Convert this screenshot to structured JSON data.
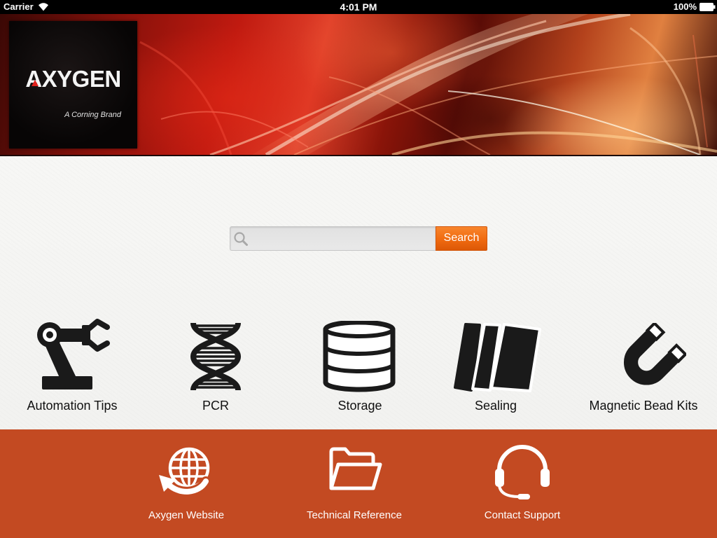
{
  "status_bar": {
    "carrier": "Carrier",
    "time": "4:01 PM",
    "battery_percent": "100%",
    "wifi_icon": "wifi-icon",
    "battery_icon": "battery-icon"
  },
  "header": {
    "logo_text": "AXYGEN",
    "logo_tagline": "A Corning Brand"
  },
  "search": {
    "value": "",
    "icon": "search-icon",
    "button_label": "Search"
  },
  "categories": [
    {
      "label": "Automation Tips",
      "icon": "robot-arm-icon"
    },
    {
      "label": "PCR",
      "icon": "dna-icon"
    },
    {
      "label": "Storage",
      "icon": "database-icon"
    },
    {
      "label": "Sealing",
      "icon": "sealing-film-icon"
    },
    {
      "label": "Magnetic Bead Kits",
      "icon": "magnet-icon"
    }
  ],
  "footer": {
    "links": [
      {
        "label": "Axygen Website",
        "icon": "globe-icon"
      },
      {
        "label": "Technical Reference",
        "icon": "folder-icon"
      },
      {
        "label": "Contact Support",
        "icon": "headset-icon"
      }
    ]
  },
  "colors": {
    "status_bar": "#000000",
    "footer": "#c34a22",
    "search_button": "#f06a10",
    "content_background": "#f2f2f0",
    "icon_dark": "#1a1a1a",
    "icon_light": "#ffffff"
  }
}
